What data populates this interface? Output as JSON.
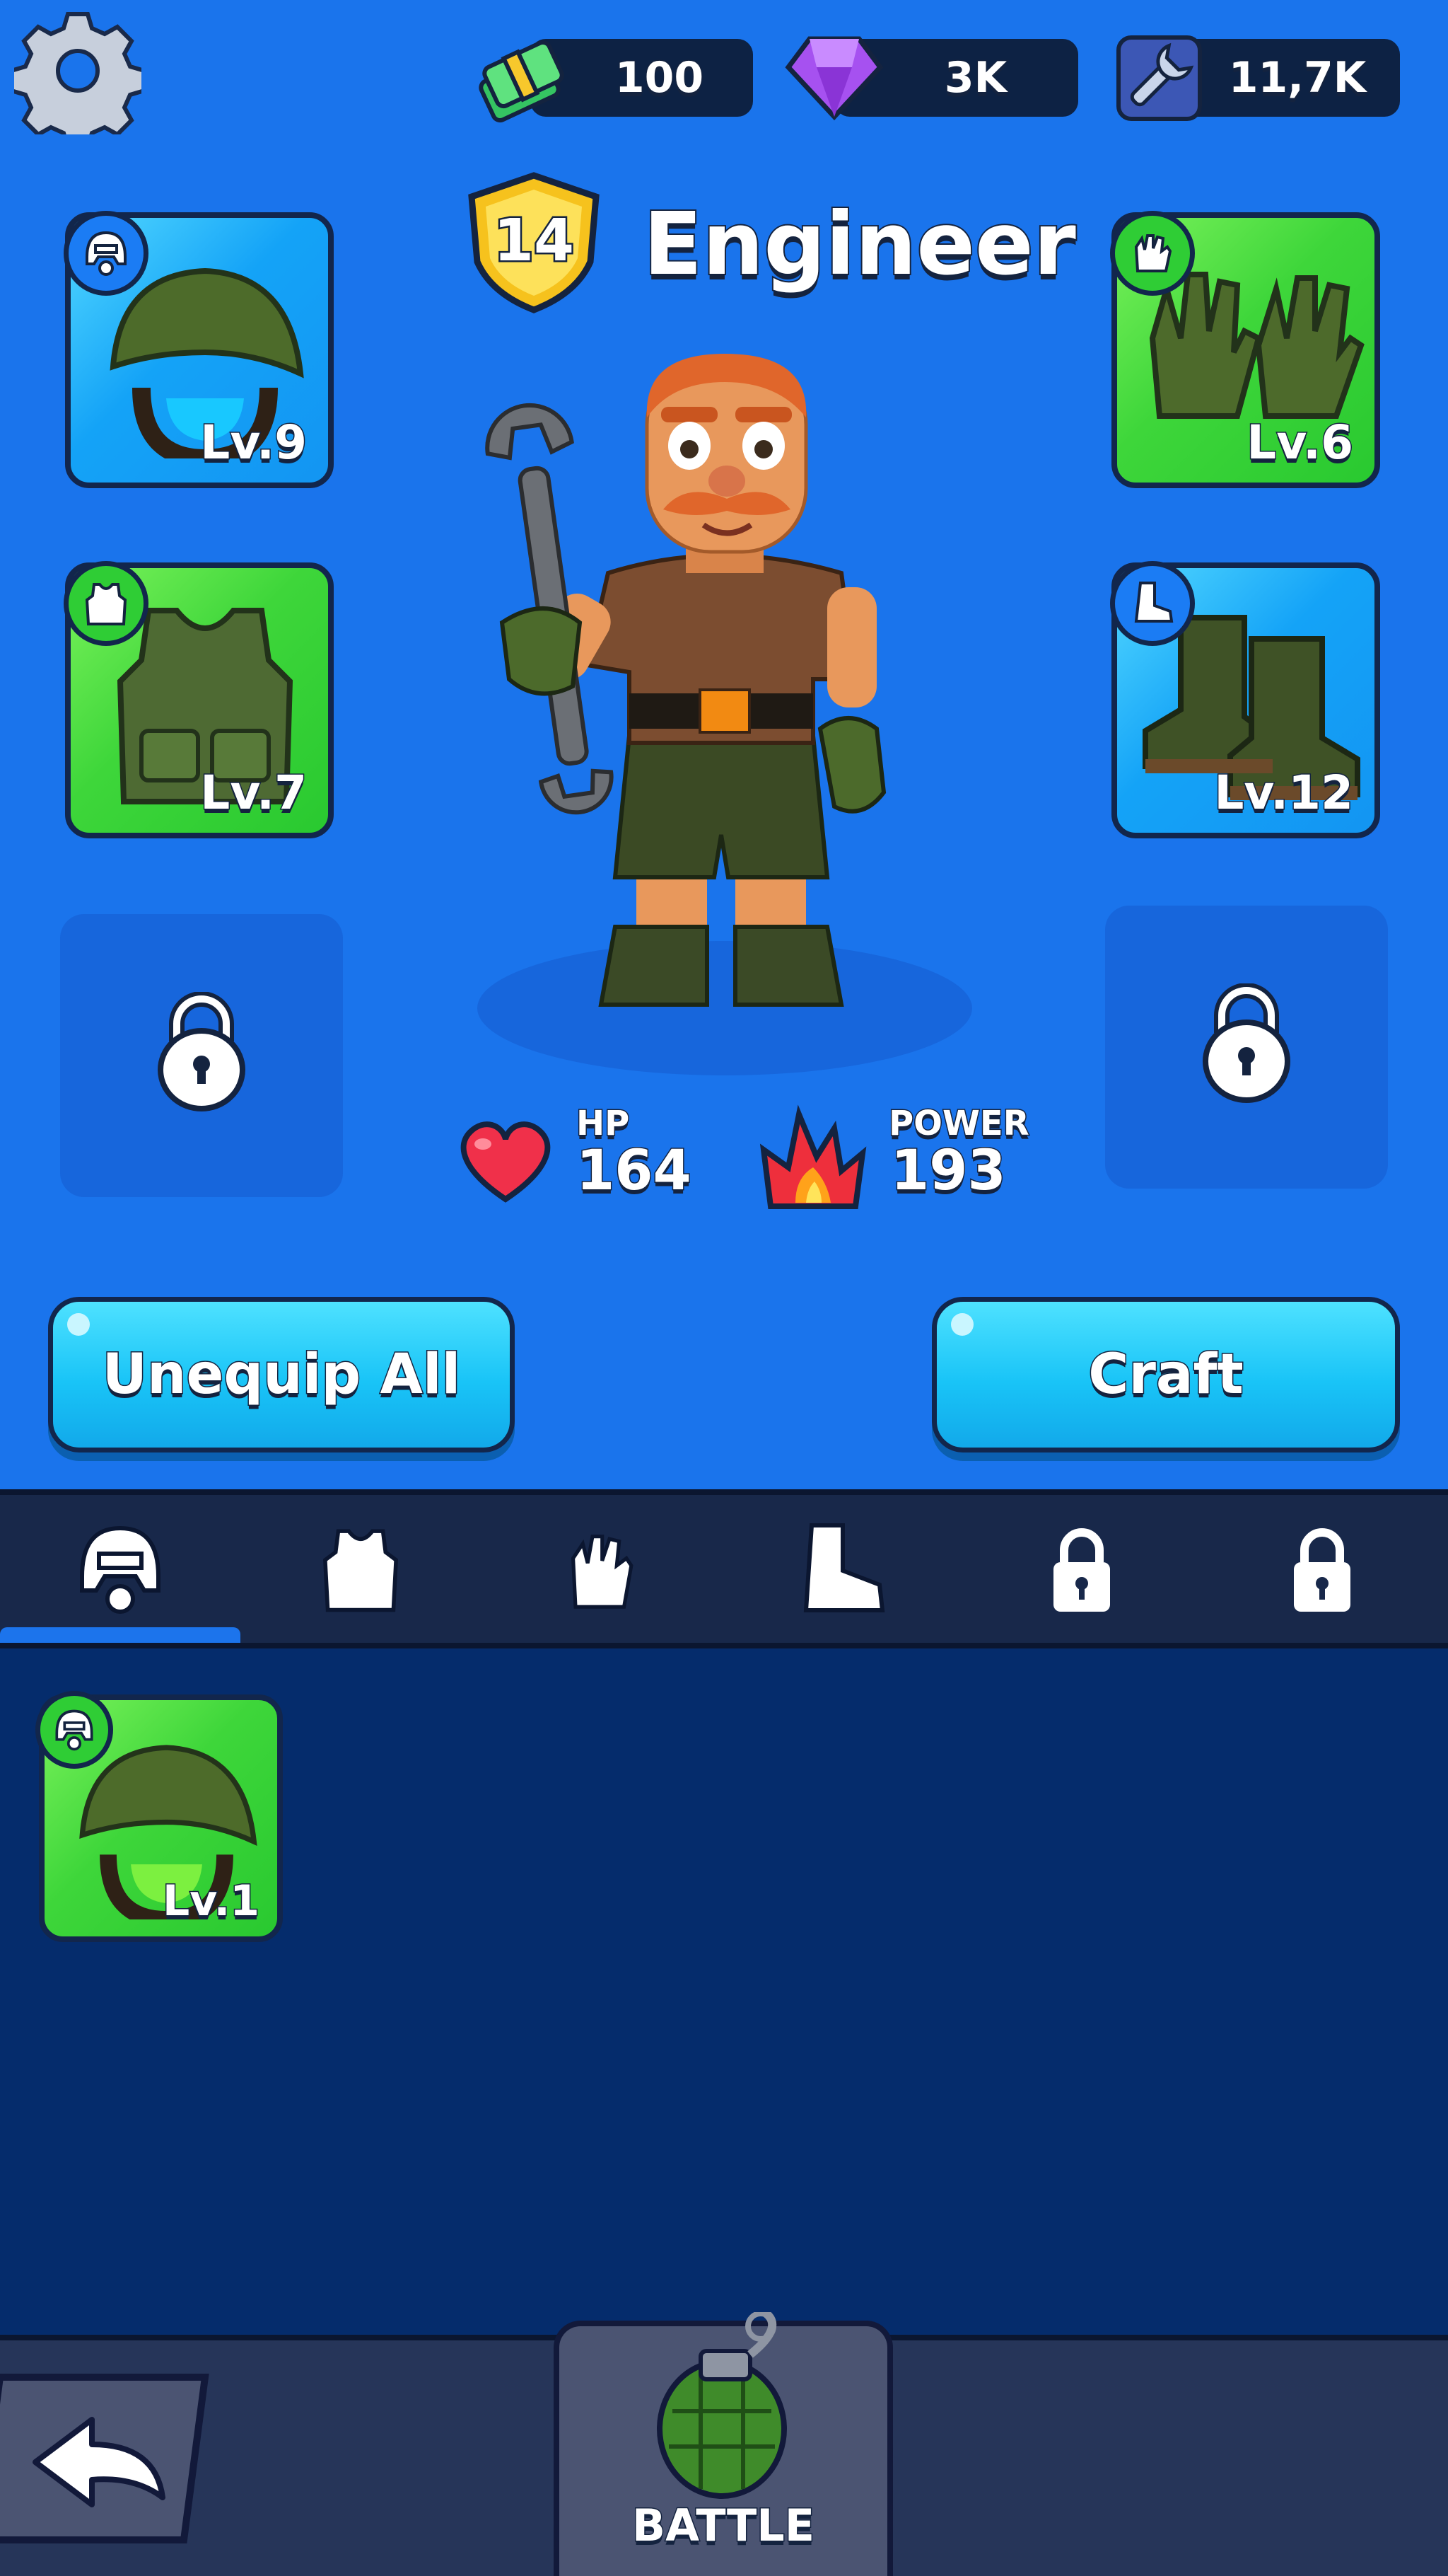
{
  "currencies": [
    {
      "name": "cash",
      "icon": "cash-stack-icon",
      "value": "100"
    },
    {
      "name": "gems",
      "icon": "purple-gem-icon",
      "value": "3K"
    },
    {
      "name": "parts",
      "icon": "wrench-icon",
      "value": "11,7K"
    }
  ],
  "hero": {
    "name": "Engineer",
    "level": "14"
  },
  "equipped": [
    {
      "slot": "helmet",
      "level": "Lv.9",
      "rarity": "blue",
      "badge_icon": "helmet-icon"
    },
    {
      "slot": "gloves",
      "level": "Lv.6",
      "rarity": "green",
      "badge_icon": "glove-icon"
    },
    {
      "slot": "vest",
      "level": "Lv.7",
      "rarity": "green",
      "badge_icon": "vest-icon"
    },
    {
      "slot": "boots",
      "level": "Lv.12",
      "rarity": "blue",
      "badge_icon": "boot-icon"
    }
  ],
  "stats": {
    "hp_label": "HP",
    "hp_value": "164",
    "power_label": "POWER",
    "power_value": "193"
  },
  "buttons": {
    "unequip_all": "Unequip All",
    "craft": "Craft"
  },
  "tabs": [
    {
      "icon": "helmet-icon",
      "active": true
    },
    {
      "icon": "vest-icon",
      "active": false
    },
    {
      "icon": "glove-icon",
      "active": false
    },
    {
      "icon": "boot-icon",
      "active": false
    },
    {
      "icon": "lock-icon",
      "active": false
    },
    {
      "icon": "lock-icon",
      "active": false
    }
  ],
  "inventory": [
    {
      "item": "helmet",
      "level": "Lv.1",
      "rarity": "green",
      "badge_icon": "helmet-icon"
    }
  ],
  "bottom_nav": {
    "battle_label": "BATTLE"
  },
  "colors": {
    "background": "#1a74ec",
    "inventory_bg": "#052c6c",
    "button_cyan": "#19c4f7",
    "rarity_blue": "#14a3f7",
    "rarity_green": "#3ed63a"
  }
}
